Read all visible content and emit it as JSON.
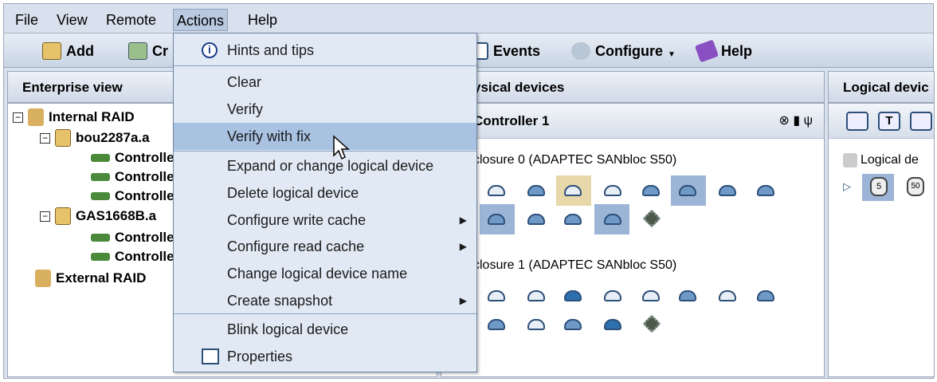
{
  "menubar": [
    "File",
    "View",
    "Remote",
    "Actions",
    "Help"
  ],
  "toolbar": {
    "add": "Add",
    "create": "Cr",
    "events": "Events",
    "configure": "Configure",
    "help": "Help"
  },
  "headers": {
    "enterprise": "Enterprise view",
    "physical": "ysical devices",
    "logical": "Logical devic"
  },
  "tree": {
    "internal": "Internal RAID",
    "host1": "bou2287a.a",
    "controller1": "Controlle",
    "controller2": "Controlle",
    "controller3": "Controlle",
    "host2": "GAS1668B.a",
    "controller4": "Controlle",
    "controller5": "Controlle",
    "external": "External RAID"
  },
  "physical": {
    "controller": "Controller 1",
    "enclosure0": "closure 0 (ADAPTEC SANbloc S50)",
    "enclosure1": "closure 1 (ADAPTEC SANbloc S50)"
  },
  "logical": {
    "label": "Logical de",
    "dev1": "5",
    "dev2": "50"
  },
  "menu": {
    "hints": "Hints and tips",
    "clear": "Clear",
    "verify": "Verify",
    "verify_fix": "Verify with fix",
    "expand": "Expand or change logical device",
    "delete": "Delete logical device",
    "write_cache": "Configure write cache",
    "read_cache": "Configure read cache",
    "change_name": "Change logical device name",
    "snapshot": "Create snapshot",
    "blink": "Blink logical device",
    "properties": "Properties"
  }
}
